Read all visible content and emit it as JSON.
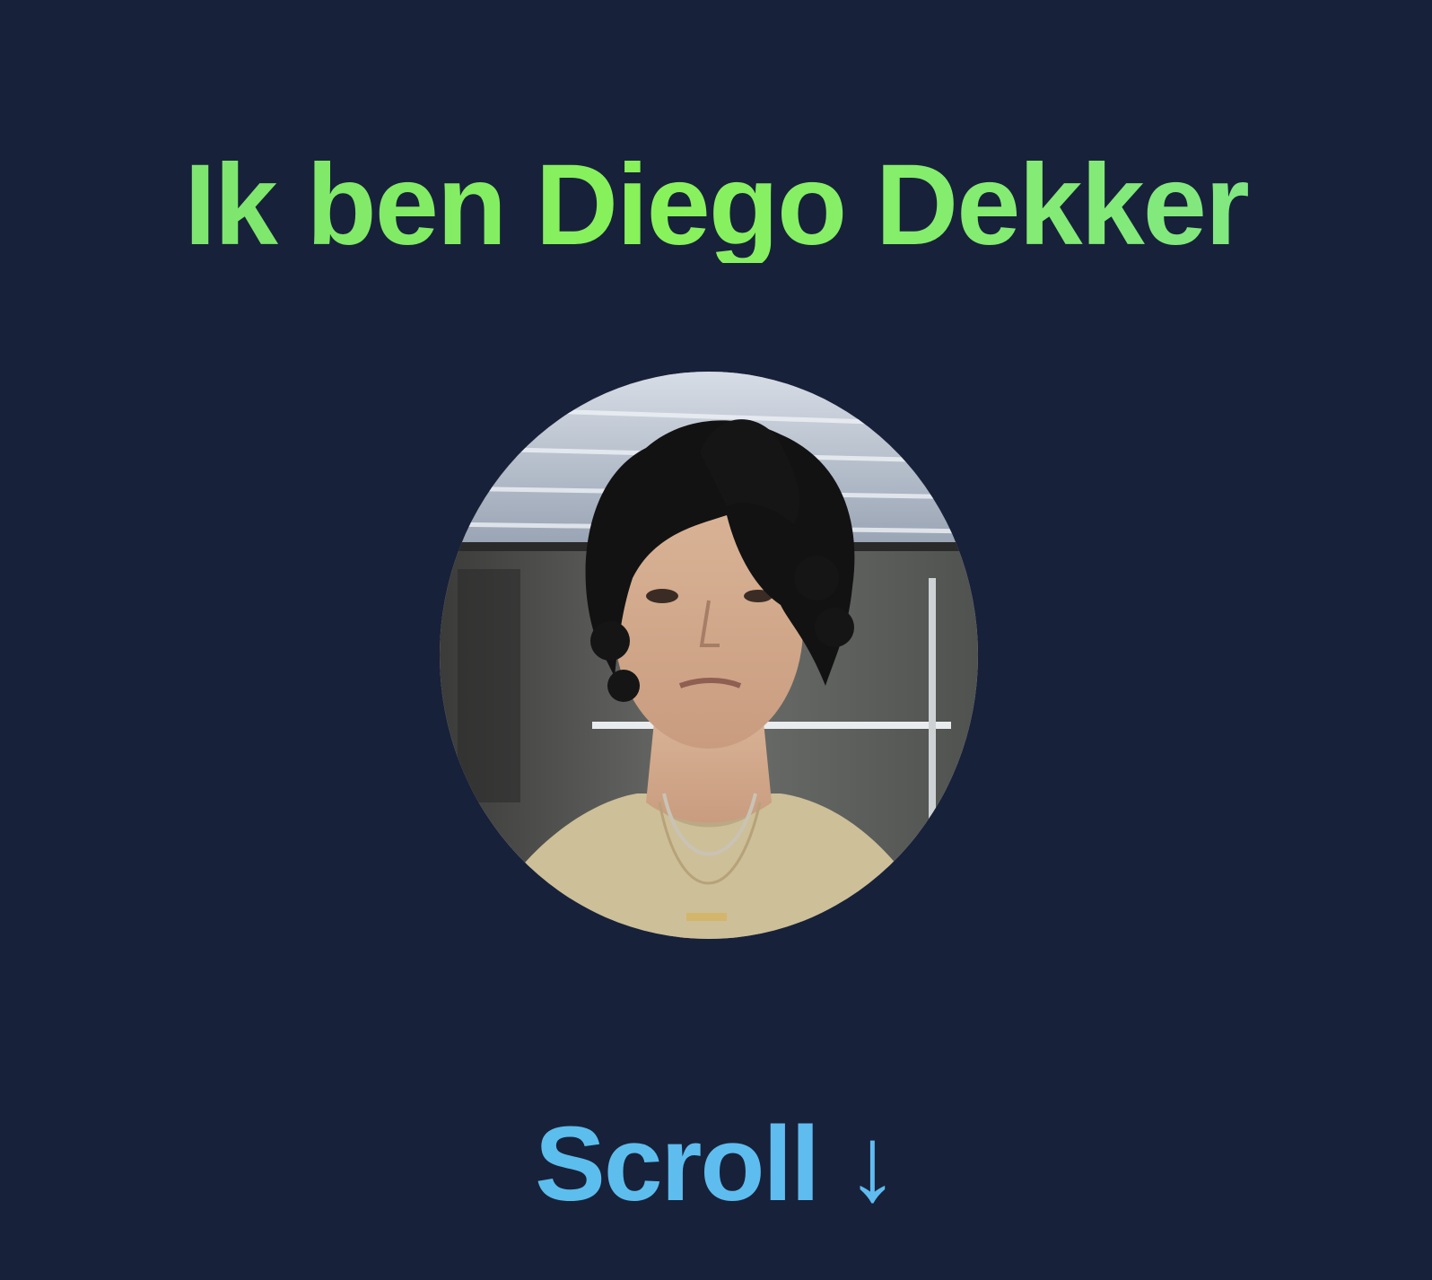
{
  "hero": {
    "title": "Ik ben Diego Dekker",
    "scroll_label": "Scroll ↓",
    "avatar_icon": "avatar-photo"
  },
  "colors": {
    "background": "#18213a",
    "title_green": "#88f25a",
    "scroll_blue": "#5fb9f0"
  }
}
